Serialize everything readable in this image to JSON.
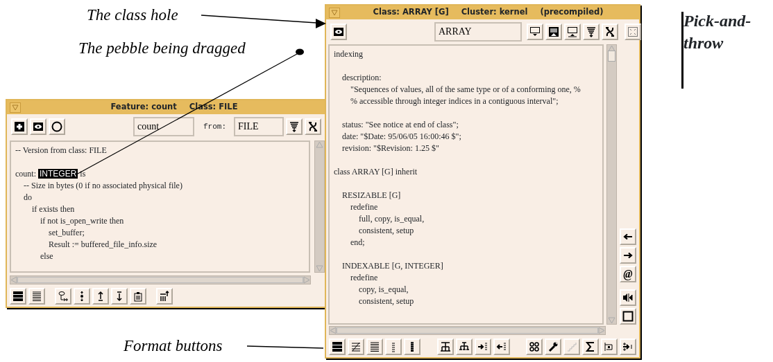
{
  "annotations": [
    {
      "kind": "class-hole",
      "text": "The class hole"
    },
    {
      "kind": "pebble",
      "text": "The pebble being dragged"
    },
    {
      "kind": "format",
      "text": "Format buttons"
    }
  ],
  "side_note": "Pick-and-throw",
  "feature_window": {
    "title": [
      "Feature: count",
      "Class: FILE"
    ],
    "left_buttons": [
      {
        "kind": "plus"
      },
      {
        "kind": "eye"
      },
      {
        "kind": "ring"
      }
    ],
    "feature_field": {
      "value": "count"
    },
    "from_label": "from:",
    "class_field": {
      "value": "FILE"
    },
    "right_buttons": [
      {
        "kind": "filter"
      },
      {
        "kind": "aleph"
      }
    ],
    "code": [
      {
        "text": "-- Version from class: FILE"
      },
      {
        "space_before": true,
        "segments": [
          {
            "text": "count:",
            "selected": false
          },
          {
            "text": "INTEGER",
            "selected": true
          },
          {
            "text": "is",
            "selected": false
          }
        ],
        "children": [
          {
            "text": "-- Size in bytes (0 if no associated physical file)"
          },
          {
            "text": "do",
            "children": [
              {
                "text": "if exists then",
                "children": [
                  {
                    "text": "if not is_open_write then",
                    "children": [
                      {
                        "text": "set_buffer;"
                      },
                      {
                        "text": "Result := buffered_file_info.size"
                      }
                    ]
                  },
                  {
                    "text": "else"
                  }
                ]
              }
            ]
          }
        ]
      }
    ],
    "bottom_toolbar": [
      [
        {
          "kind": "thick-lines"
        },
        {
          "kind": "lines"
        }
      ],
      [
        {
          "kind": "flow-plus"
        },
        {
          "kind": "dot-arrows"
        },
        {
          "kind": "up-arrow"
        },
        {
          "kind": "down-arrow"
        },
        {
          "kind": "clipboard"
        }
      ],
      [
        {
          "kind": "bars-up"
        }
      ]
    ]
  },
  "class_window": {
    "title": [
      "Class: ARRAY [G]",
      "Cluster: kernel",
      "(precompiled)"
    ],
    "left_buttons": [
      {
        "kind": "eye"
      }
    ],
    "class_field": {
      "value": "ARRAY"
    },
    "right_buttons": [
      {
        "kind": "tray-down"
      },
      {
        "kind": "tray-filled"
      },
      {
        "kind": "tray-up"
      },
      {
        "kind": "filter"
      },
      {
        "kind": "aleph"
      }
    ],
    "corner_button": {
      "kind": "expand"
    },
    "code": [
      {
        "text": "indexing",
        "children": [
          {
            "space_before": true,
            "text": "description:",
            "children": [
              {
                "text": "\"Sequences of values, all of the same type or of a conforming one, %"
              },
              {
                "text": "% accessible through integer indices in a contiguous interval\";"
              }
            ]
          },
          {
            "space_before": true,
            "text": "status: \"See notice at end of class\";"
          },
          {
            "text": "date: \"$Date: 95/06/05 16:00:46 $\";"
          },
          {
            "text": "revision: \"$Revision: 1.25 $\""
          }
        ]
      },
      {
        "space_before": true,
        "text": "class ARRAY [G] inherit",
        "children": [
          {
            "space_before": true,
            "text": "RESIZABLE [G]",
            "children": [
              {
                "text": "redefine",
                "children": [
                  {
                    "text": "full, copy, is_equal,"
                  },
                  {
                    "text": "consistent, setup"
                  }
                ]
              },
              {
                "text": "end;"
              }
            ]
          },
          {
            "space_before": true,
            "text": "INDEXABLE [G, INTEGER]",
            "children": [
              {
                "text": "redefine",
                "children": [
                  {
                    "text": "copy, is_equal,"
                  },
                  {
                    "text": "consistent, setup"
                  }
                ]
              }
            ]
          }
        ]
      }
    ],
    "side_buttons": [
      [
        {
          "kind": "left-arrow"
        },
        {
          "kind": "right-arrow"
        },
        {
          "kind": "label",
          "label": "@"
        }
      ],
      [
        {
          "kind": "speaker"
        },
        {
          "kind": "square"
        }
      ]
    ],
    "bottom_toolbar": [
      [
        {
          "kind": "thick-lines"
        },
        {
          "kind": "slant-lines"
        },
        {
          "kind": "lines"
        },
        {
          "kind": "dashes"
        },
        {
          "kind": "dense-lines"
        }
      ],
      [
        {
          "kind": "tree"
        },
        {
          "kind": "tree-down"
        },
        {
          "kind": "arrow-in-list"
        },
        {
          "kind": "arrow-out-list"
        }
      ],
      [
        {
          "kind": "circles"
        },
        {
          "kind": "wrench"
        },
        {
          "kind": "steps"
        },
        {
          "kind": "sigma"
        },
        {
          "kind": "node"
        },
        {
          "kind": "arrows-right"
        }
      ]
    ]
  }
}
